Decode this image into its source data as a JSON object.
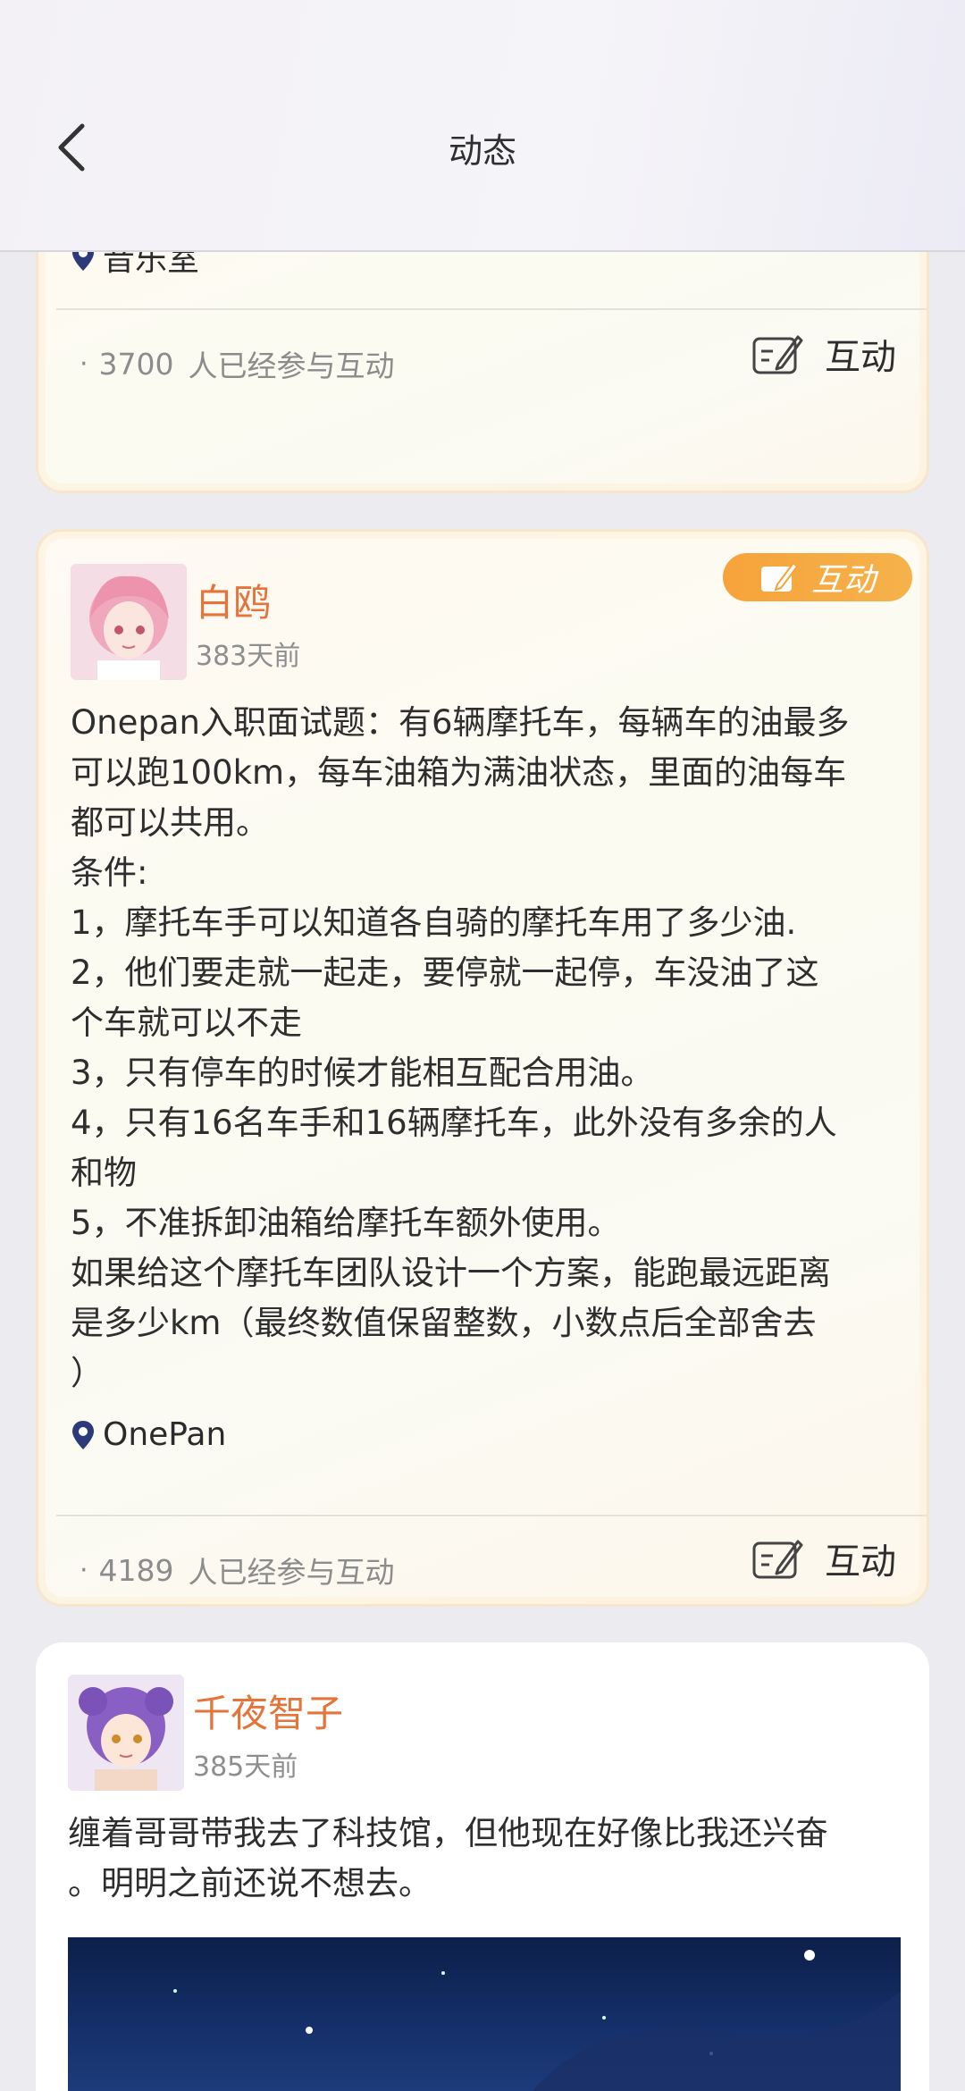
{
  "header": {
    "title": "动态",
    "back_icon": "chevron-left-icon"
  },
  "posts": [
    {
      "location": "音乐室",
      "participants_count": "3700",
      "participants_label": "人已经参与互动",
      "interact_label": "互动"
    },
    {
      "username": "白鸥",
      "time": "383天前",
      "badge_label": "互动",
      "content": "Onepan入职面试题：有6辆摩托车，每辆车的油最多\n可以跑100km，每车油箱为满油状态，里面的油每车\n都可以共用。\n条件:\n1，摩托车手可以知道各自骑的摩托车用了多少油.\n2，他们要走就一起走，要停就一起停，车没油了这\n个车就可以不走\n3，只有停车的时候才能相互配合用油。\n4，只有16名车手和16辆摩托车，此外没有多余的人\n和物\n5，不准拆卸油箱给摩托车额外使用。\n如果给这个摩托车团队设计一个方案，能跑最远距离\n是多少km（最终数值保留整数，小数点后全部舍去\n）",
      "location": "OnePan",
      "participants_count": "4189",
      "participants_label": "人已经参与互动",
      "interact_label": "互动"
    },
    {
      "username": "千夜智子",
      "time": "385天前",
      "content": "缠着哥哥带我去了科技馆，但他现在好像比我还兴奋\n。明明之前还说不想去。"
    }
  ],
  "colors": {
    "accent_orange": "#e5743a",
    "badge_orange": "#f7a33b",
    "location_pin": "#2c3a7a"
  }
}
